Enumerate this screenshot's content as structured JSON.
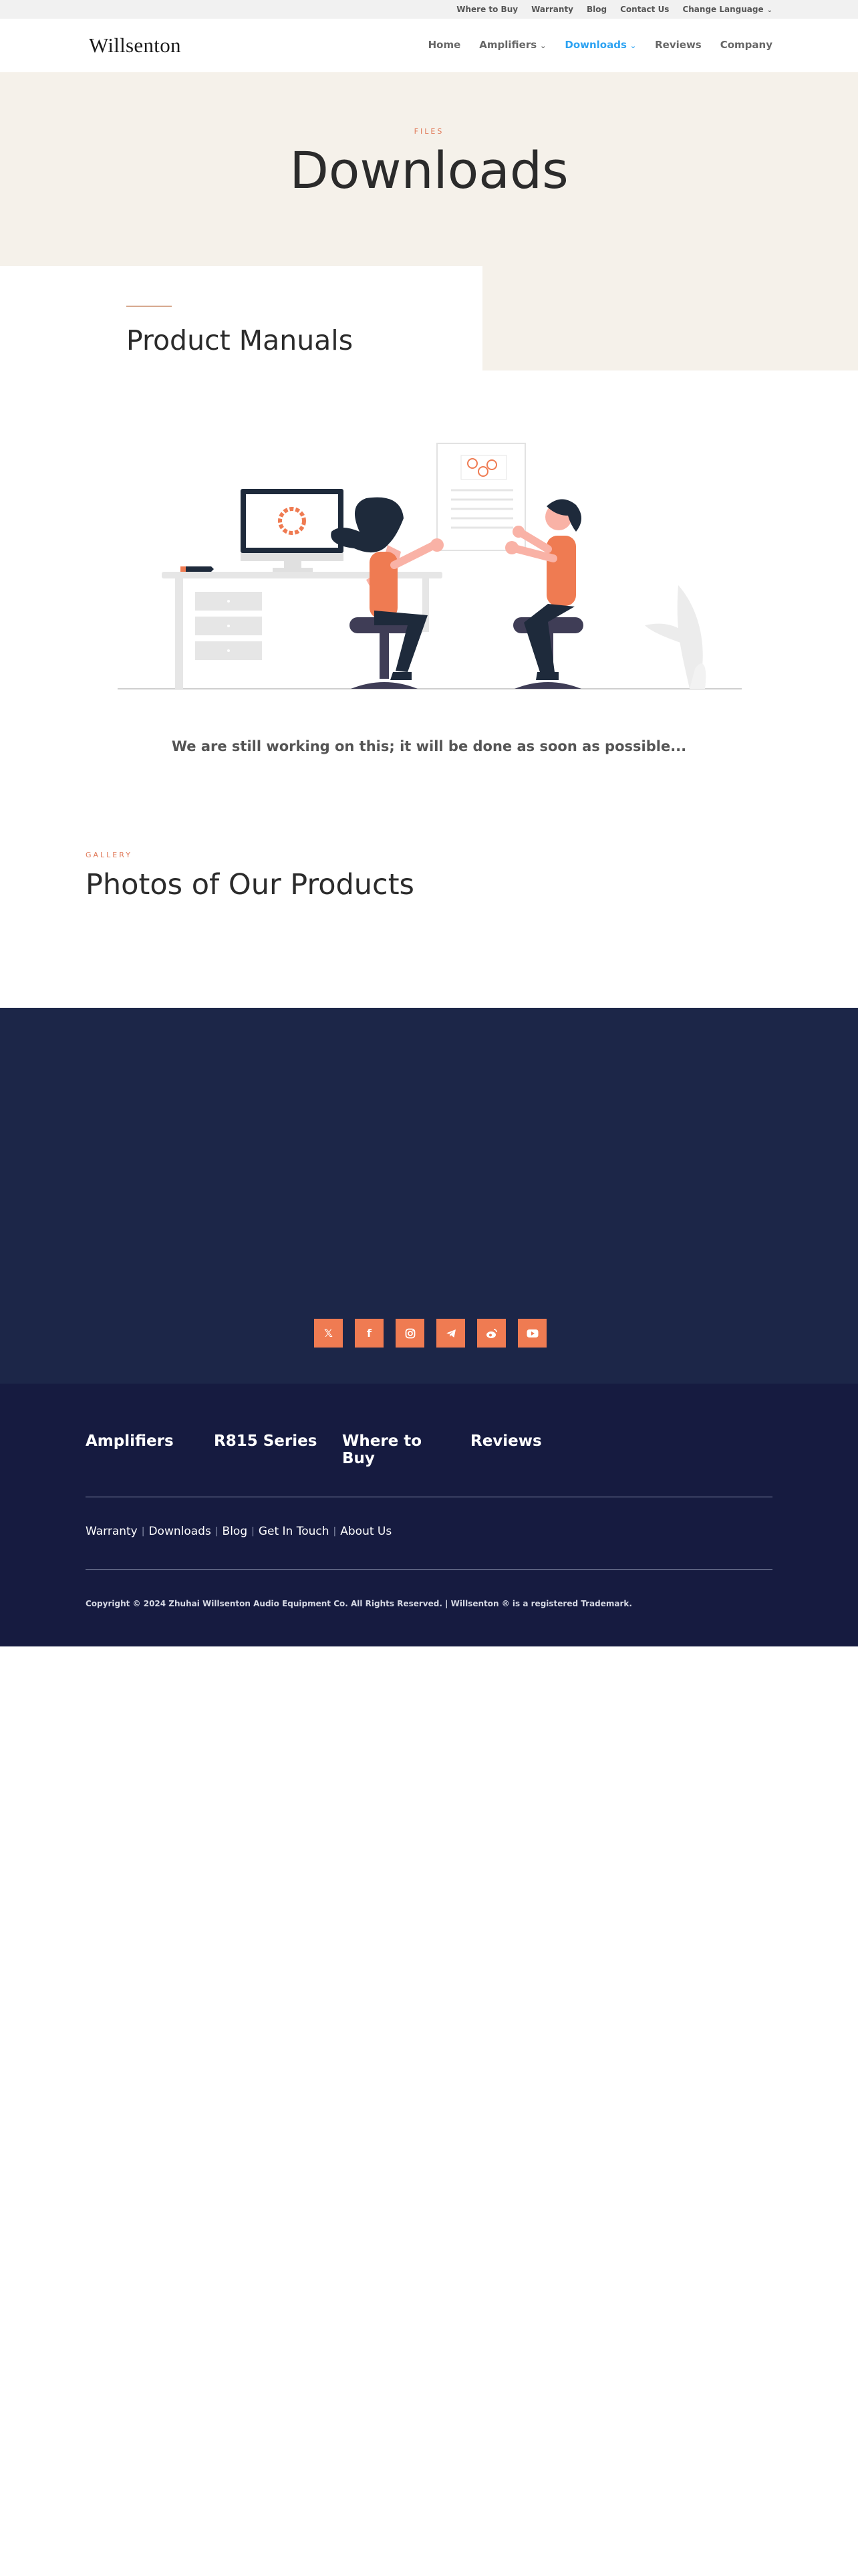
{
  "topbar": {
    "links": [
      "Where to Buy",
      "Warranty",
      "Blog",
      "Contact Us",
      "Change Language"
    ]
  },
  "header": {
    "logo": "Willsenton",
    "nav": [
      "Home",
      "Amplifiers",
      "Downloads",
      "Reviews",
      "Company"
    ],
    "active_nav": "Downloads"
  },
  "hero": {
    "kicker": "FILES",
    "title": "Downloads"
  },
  "manuals": {
    "title": "Product Manuals"
  },
  "status": {
    "message": "We are still working on this; it will be done as soon as possible..."
  },
  "gallery": {
    "kicker": "GALLERY",
    "title": "Photos of Our Products"
  },
  "social": {
    "icons": [
      "x-icon",
      "facebook-icon",
      "instagram-icon",
      "telegram-icon",
      "weibo-icon",
      "youtube-icon"
    ]
  },
  "footer": {
    "columns": [
      "Amplifiers",
      "R815 Series",
      "Where to Buy",
      "Reviews"
    ],
    "links": [
      "Warranty",
      "Downloads",
      "Blog",
      "Get In Touch",
      "About Us"
    ],
    "copyright": "Copyright © 2024 Zhuhai Willsenton Audio Equipment Co. All Rights Reserved. | Willsenton ® is a registered Trademark."
  },
  "colors": {
    "accent": "#ef7b52",
    "link_active": "#2ea3f2",
    "hero_bg": "#f5f1ea",
    "footer_top": "#1c2648",
    "footer_bottom": "#161b40"
  }
}
